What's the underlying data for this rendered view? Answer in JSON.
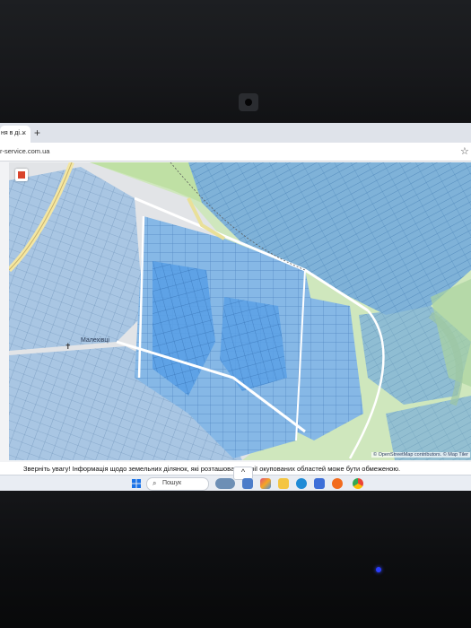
{
  "browser": {
    "tab_title": "ня в ді...",
    "tab_close": "×",
    "new_tab": "+",
    "url": "r-service.com.ua",
    "star": "☆"
  },
  "map": {
    "stop_button": "stop-button",
    "place_label": "Малехівцi",
    "attribution": "© OpenStreetMap contributors. © Map Tiler"
  },
  "notice": {
    "text": "Зверніть увагу! Інформація щодо земельних ділянок, які розташова      риторії окупованих областей може бути обмеженою."
  },
  "taskbar": {
    "tray_arrow": "^",
    "search_placeholder": "Пошук",
    "apps": [
      "weather-icon",
      "photos-icon",
      "file-explorer-icon",
      "edge-icon",
      "store-icon",
      "firefox-icon",
      "chrome-icon"
    ]
  },
  "colors": {
    "parcel_blue": "#7fb2e3",
    "parcel_blue_dark": "#3f8fe0",
    "base_green": "#c8e6b0",
    "base_grey": "#e3e4e6",
    "road_yellow": "#f0e6a0",
    "led_blue": "#2a3dff"
  }
}
